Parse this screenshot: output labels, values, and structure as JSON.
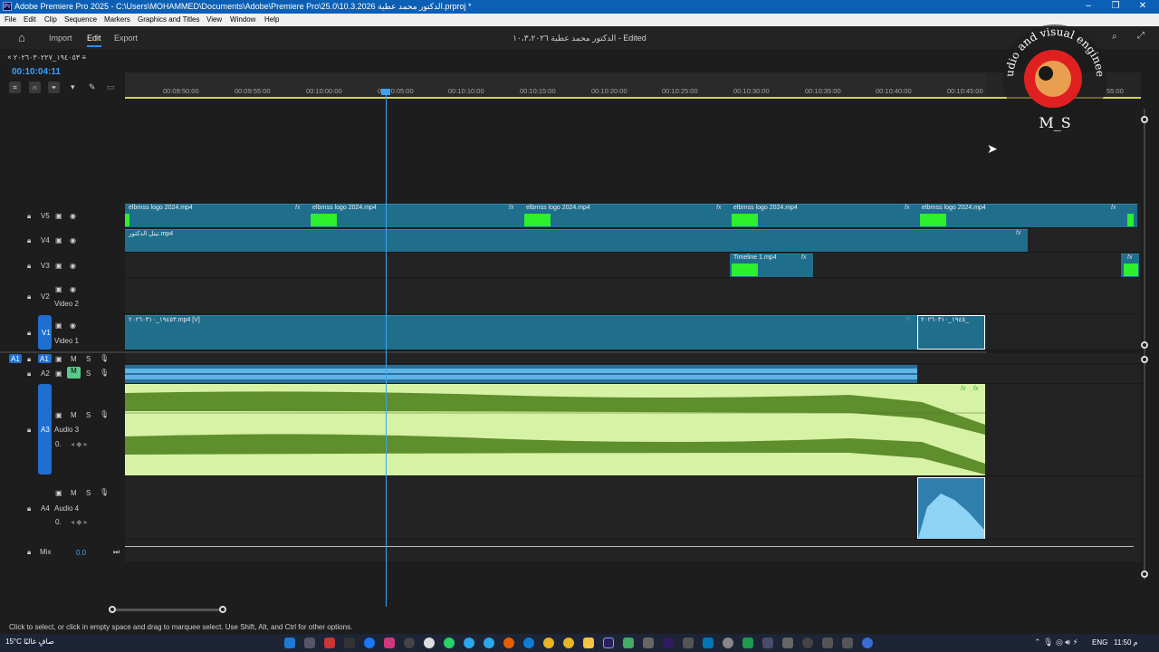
{
  "window": {
    "title": "Adobe Premiere Pro 2025 - C:\\Users\\MOHAMMED\\Documents\\Adobe\\Premiere Pro\\25.0\\10.3.2026 الدكتور محمد عطية.prproj *",
    "logo_text": "Pr"
  },
  "menu": [
    "File",
    "Edit",
    "Clip",
    "Sequence",
    "Markers",
    "Graphics and Titles",
    "View",
    "Window",
    "Help"
  ],
  "appbar": {
    "import": "Import",
    "edit": "Edit",
    "export": "Export",
    "doc_title": "الدكتور محمد عطية ١٠،٣،٢٠٢٦ - Edited"
  },
  "sequence": {
    "tab_label": "١٩٤٠٥٣_٢٠٢٦٠٣٠٢٢٧",
    "timecode": "00:10:04:11"
  },
  "ruler": {
    "ticks": [
      "00:09:50:00",
      "00:09:55:00",
      "00:10:00:00",
      "00:10:05:00",
      "00:10:10:00",
      "00:10:15:00",
      "00:10:20:00",
      "00:10:25:00",
      "00:10:30:00",
      "00:10:35:00",
      "00:10:40:00",
      "00:10:45:00"
    ],
    "right_tick": "55:00"
  },
  "tracks": {
    "v5": "V5",
    "v4": "V4",
    "v3": "V3",
    "v2": "V2",
    "v2_name": "Video 2",
    "v1": "V1",
    "v1_name": "Video 1",
    "a1": "A1",
    "a2": "A2",
    "a3": "A3",
    "a3_name": "Audio 3",
    "a3_vol": "0.",
    "a4": "A4",
    "a4_name": "Audio 4",
    "a4_vol": "0.",
    "mix": "Mix",
    "mix_val": "0.0",
    "m": "M",
    "s": "S"
  },
  "clips": {
    "v5_label": "elbrnss logo 2024.mp4",
    "v4_label": "تيتل الدكتور.mp4",
    "v3_label": "Timeline 1.mp4",
    "v1_label": "١٩٤٥٣_٢٠٢٦٠٣١٠.mp4 [V]",
    "v1b_label": "١٩٤٥_٢٠٢٦٠٣١٠_"
  },
  "fx_label": "fx",
  "status": "Click to select, or click in empty space and drag to marquee select. Use Shift, Alt, and Ctrl for other options.",
  "watermark": {
    "arc_text": "udio and visual engineering",
    "initials": "M_S"
  },
  "taskbar": {
    "weather": "15°C صافٍ غالبًا",
    "lang": "ENG",
    "time": "11:50 م"
  },
  "colors": {
    "accent": "#2d8ceb",
    "clip_blue": "#1f6e8c",
    "clip_green": "#2cf02c",
    "audio_green": "#d6f2a4",
    "waveform": "#5f8e2d",
    "a2_audio": "#4ea7dd"
  }
}
